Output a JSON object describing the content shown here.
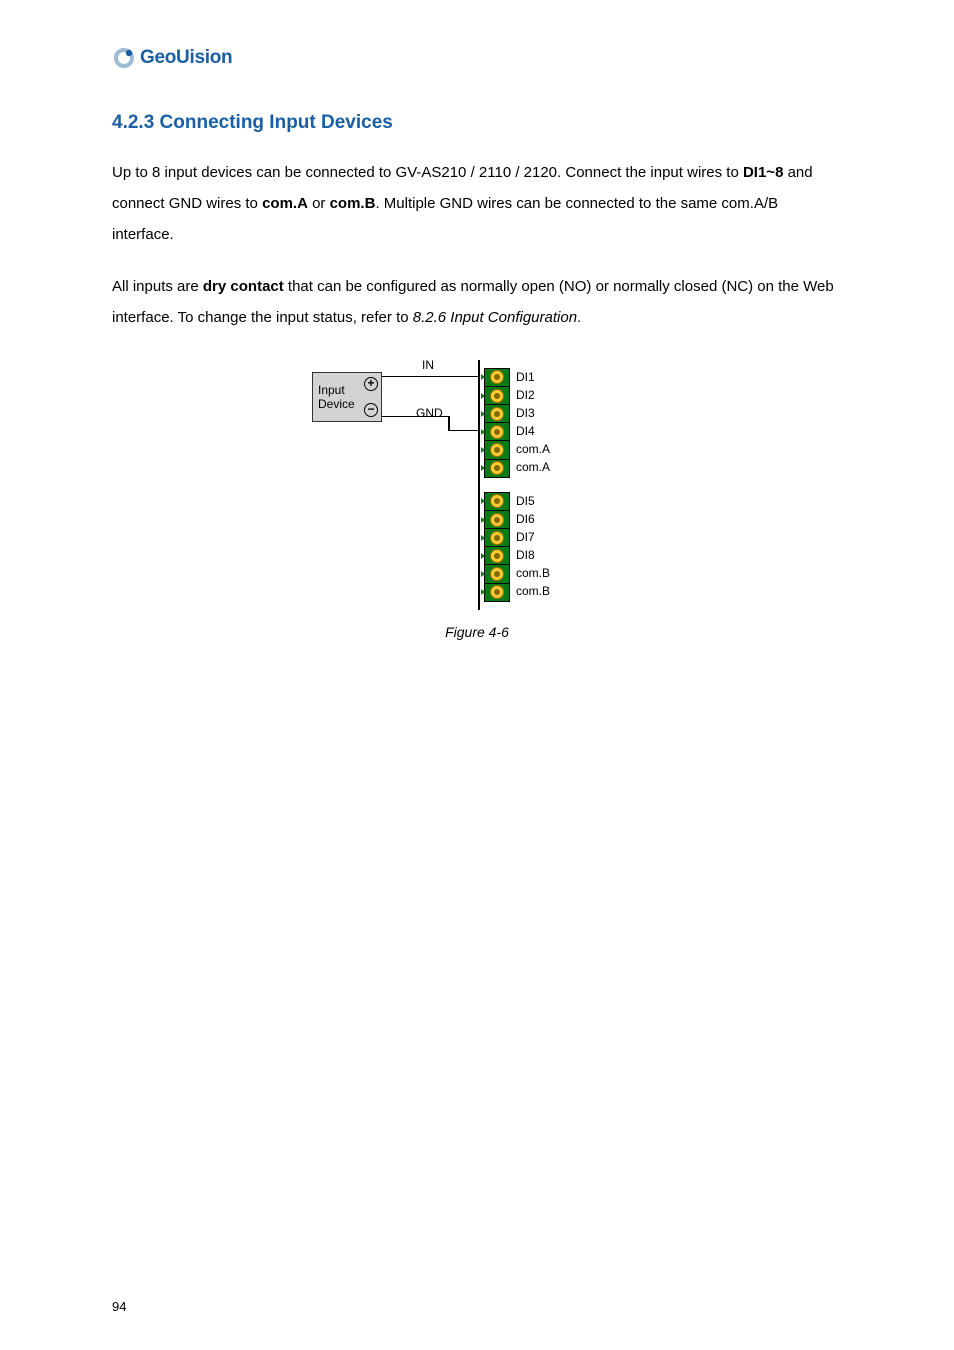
{
  "logo": {
    "brand": "GeoUision"
  },
  "section_title": "4.2.3 Connecting Input Devices",
  "para1": {
    "t1": "Up to 8 input devices can be connected to GV-AS210 / 2110 / 2120. Connect the input wires to ",
    "b1": "DI1~8",
    "t2": " and connect GND wires to ",
    "b2": "com.A",
    "t3": " or ",
    "b3": "com.B",
    "t4": ". Multiple GND wires can be connected to the same com.A/B interface."
  },
  "para2": {
    "t1": "All inputs are ",
    "b1": "dry contact",
    "t2": " that can be configured as normally open (NO) or normally closed (NC) on the Web interface. To change the input status, refer to ",
    "i1": "8.2.6 Input Configuration",
    "t3": "."
  },
  "diagram": {
    "device": "Input\nDevice",
    "plus": "+",
    "minus": "−",
    "in_label": "IN",
    "gnd_label": "GND",
    "top_pins": [
      "DI1",
      "DI2",
      "DI3",
      "DI4",
      "com.A",
      "com.A"
    ],
    "bot_pins": [
      "DI5",
      "DI6",
      "DI7",
      "DI8",
      "com.B",
      "com.B"
    ]
  },
  "figure_caption": "Figure 4-6",
  "page_number": "94"
}
